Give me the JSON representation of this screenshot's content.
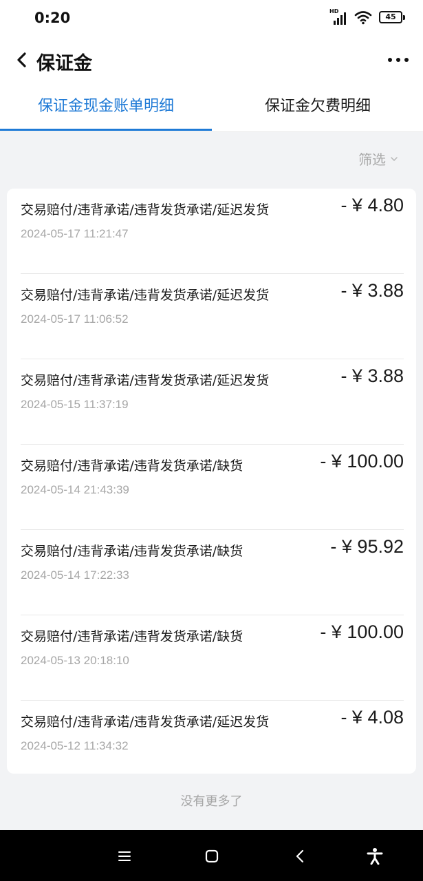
{
  "status_bar": {
    "time": "0:20",
    "network_label": "HD",
    "battery_level": "45"
  },
  "header": {
    "title": "保证金"
  },
  "tabs": [
    {
      "label": "保证金现金账单明细",
      "active": true
    },
    {
      "label": "保证金欠费明细",
      "active": false
    }
  ],
  "filter": {
    "label": "筛选"
  },
  "transactions": [
    {
      "title": "交易赔付/违背承诺/违背发货承诺/延迟发货",
      "time": "2024-05-17 11:21:47",
      "amount": "- ¥ 4.80"
    },
    {
      "title": "交易赔付/违背承诺/违背发货承诺/延迟发货",
      "time": "2024-05-17 11:06:52",
      "amount": "- ¥ 3.88"
    },
    {
      "title": "交易赔付/违背承诺/违背发货承诺/延迟发货",
      "time": "2024-05-15 11:37:19",
      "amount": "- ¥ 3.88"
    },
    {
      "title": "交易赔付/违背承诺/违背发货承诺/缺货",
      "time": "2024-05-14 21:43:39",
      "amount": "- ¥ 100.00"
    },
    {
      "title": "交易赔付/违背承诺/违背发货承诺/缺货",
      "time": "2024-05-14 17:22:33",
      "amount": "- ¥ 95.92"
    },
    {
      "title": "交易赔付/违背承诺/违背发货承诺/缺货",
      "time": "2024-05-13 20:18:10",
      "amount": "- ¥ 100.00"
    },
    {
      "title": "交易赔付/违背承诺/违背发货承诺/延迟发货",
      "time": "2024-05-12 11:34:32",
      "amount": "- ¥ 4.08"
    }
  ],
  "footer": {
    "no_more": "没有更多了"
  },
  "colors": {
    "accent": "#1f7ad6",
    "page_background": "#f2f3f5",
    "muted_text": "#a6a6a6"
  },
  "icons": {
    "back": "chevron-left-icon",
    "more": "more-horizontal-icon",
    "filter_arrow": "chevron-down-icon",
    "wifi": "wifi-icon",
    "signal": "signal-icon",
    "battery": "battery-icon",
    "nav_menu": "menu-icon",
    "nav_home": "home-square-icon",
    "nav_back": "back-triangle-icon",
    "nav_accessibility": "accessibility-icon"
  }
}
